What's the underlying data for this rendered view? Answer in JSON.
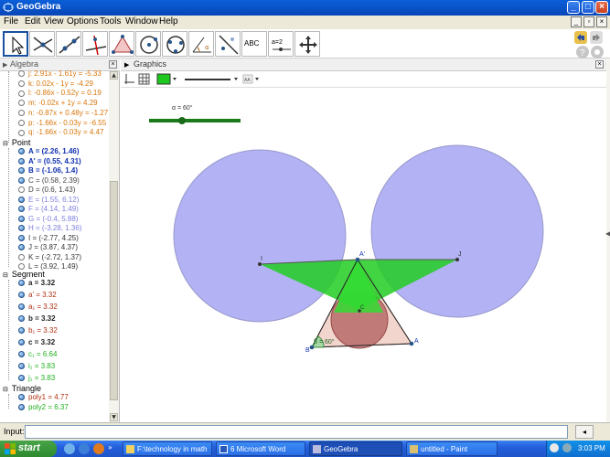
{
  "window": {
    "title": "GeoGebra"
  },
  "menu": {
    "items": [
      "File",
      "Edit",
      "View",
      "Options",
      "Tools",
      "Window",
      "Help"
    ]
  },
  "toolbar": {
    "tools": [
      "move-tool",
      "point-tool",
      "line-tool",
      "perpendicular-tool",
      "polygon-tool",
      "circle-tool",
      "conic-tool",
      "angle-tool",
      "reflect-tool",
      "text-tool",
      "slider-tool",
      "move-view-tool"
    ],
    "text_tool_label": "ABC",
    "slider_tool_label": "a=2"
  },
  "algebra": {
    "title": "Algebra",
    "lines": [
      {
        "text": "j: 2.91x - 1.61y = -5.33",
        "color": "#d9760a"
      },
      {
        "text": "k: 0.02x - 1y = -4.29",
        "color": "#d9760a"
      },
      {
        "text": "l: -0.86x - 0.52y = 0.19",
        "color": "#d9760a"
      },
      {
        "text": "m: -0.02x + 1y = 4.29",
        "color": "#d9760a"
      },
      {
        "text": "n: -0.87x + 0.48y = -1.27",
        "color": "#d9760a"
      },
      {
        "text": "p: -1.66x - 0.03y = -6.55",
        "color": "#d9760a"
      },
      {
        "text": "q: -1.66x - 0.03y = 4.47",
        "color": "#d9760a"
      }
    ],
    "point_group": "Point",
    "points": [
      {
        "text": "A = (2.26, 1.46)",
        "color": "#1030b0",
        "bold": true,
        "shown": true
      },
      {
        "text": "A' = (0.55, 4.31)",
        "color": "#1030b0",
        "bold": true,
        "shown": true
      },
      {
        "text": "B = (-1.06, 1.4)",
        "color": "#1030b0",
        "bold": true,
        "shown": true
      },
      {
        "text": "C = (0.58, 2.39)",
        "color": "#444444",
        "bold": false,
        "shown": true
      },
      {
        "text": "D = (0.6, 1.43)",
        "color": "#444444",
        "bold": false,
        "shown": false
      },
      {
        "text": "E = (1.55, 6.12)",
        "color": "#7f7fe0",
        "bold": false,
        "shown": true
      },
      {
        "text": "F = (4.14, 1.49)",
        "color": "#7f7fe0",
        "bold": false,
        "shown": true
      },
      {
        "text": "G = (-0.4, 5.88)",
        "color": "#7f7fe0",
        "bold": false,
        "shown": true
      },
      {
        "text": "H = (-3.28, 1.36)",
        "color": "#7f7fe0",
        "bold": false,
        "shown": true
      },
      {
        "text": "I = (-2.77, 4.25)",
        "color": "#333333",
        "bold": false,
        "shown": true
      },
      {
        "text": "J = (3.87, 4.37)",
        "color": "#333333",
        "bold": false,
        "shown": true
      },
      {
        "text": "K = (-2.72, 1.37)",
        "color": "#333333",
        "bold": false,
        "shown": false
      },
      {
        "text": "L = (3.92, 1.49)",
        "color": "#333333",
        "bold": false,
        "shown": false
      }
    ],
    "segment_group": "Segment",
    "segments": [
      {
        "text": "a = 3.32",
        "color": "#222222",
        "bold": true
      },
      {
        "text": "a' = 3.32",
        "color": "#b03010",
        "bold": false
      },
      {
        "text": "a₁ = 3.32",
        "color": "#b03010",
        "bold": false
      },
      {
        "text": "b = 3.32",
        "color": "#222222",
        "bold": true
      },
      {
        "text": "b₁ = 3.32",
        "color": "#b03010",
        "bold": false
      },
      {
        "text": "c = 3.32",
        "color": "#222222",
        "bold": true
      },
      {
        "text": "c₁ = 6.64",
        "color": "#20b020",
        "bold": false
      },
      {
        "text": "i₁ = 3.83",
        "color": "#20b020",
        "bold": false
      },
      {
        "text": "j₁ = 3.83",
        "color": "#20b020",
        "bold": false
      }
    ],
    "triangle_group": "Triangle",
    "triangles": [
      {
        "text": "poly1 = 4.77",
        "color": "#b03010",
        "bold": false
      },
      {
        "text": "poly2 = 6.37",
        "color": "#20b020",
        "bold": false
      }
    ]
  },
  "graphics": {
    "title": "Graphics",
    "slider_label": "α = 60°",
    "slider_value_fraction": 0.36,
    "angle_label": "β = 60°",
    "point_labels": {
      "A": "A",
      "B": "B",
      "Aprime": "A'",
      "I": "I",
      "J": "J",
      "C": "C"
    },
    "colors": {
      "circle": "#9c9cf0",
      "green": "#1ec81e",
      "brown": "#c07a70",
      "line": "#555555"
    }
  },
  "input": {
    "label": "Input:"
  },
  "taskbar": {
    "start_label": "start",
    "tasks": [
      "F:\\technology in math",
      "6 Microsoft Word",
      "GeoGebra",
      "untitled - Paint"
    ],
    "clock": "3:03 PM"
  }
}
